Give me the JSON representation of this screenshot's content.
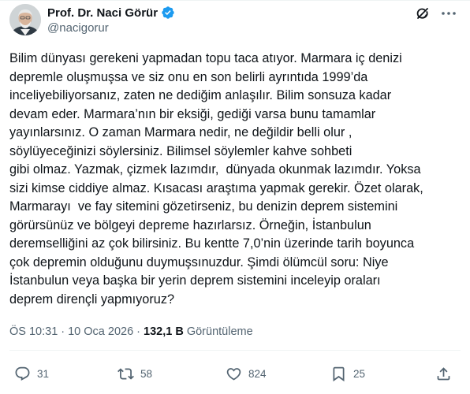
{
  "author": {
    "name": "Prof. Dr. Naci Görür",
    "handle": "@nacigorur",
    "verified": true
  },
  "tweet": {
    "lines": [
      "Bilim dünyası gerekeni yapmadan topu taca atıyor. Marmara iç denizi",
      "depremle oluşmuşsa ve siz onu en son belirli ayrıntıda 1999’da",
      "inceliyebiliyorsanız, zaten ne dediğim anlaşılır. Bilim sonsuza kadar",
      "devam eder. Marmara’nın bir eksiği, gediği varsa bunu tamamlar",
      "yayınlarsınız. O zaman Marmara nedir, ne değildir belli olur ,",
      "söylüyeceğinizi söylersiniz. Bilimsel söylemler kahve sohbeti",
      "gibi olmaz. Yazmak, çizmek lazımdır,  dünyada okunmak lazımdır. Yoksa",
      "sizi kimse ciddiye almaz. Kısacası araştıma yapmak gerekir. Özet olarak,",
      "Marmarayı  ve fay sitemini gözetirseniz, bu denizin deprem sistemini",
      "görürsünüz ve bölgeyi depreme hazırlarsız. Örneğin, İstanbulun",
      "deremselliğini az çok bilirsiniz. Bu kentte 7,0’nin üzerinde tarih boyunca",
      "çok depremin olduğunu duymuşsınuzdur. Şimdi ölümcül soru: Niye",
      "İstanbulun veya başka bir yerin deprem sistemini inceleyip oraları",
      "deprem dirençli yapmıyoruz?"
    ]
  },
  "meta": {
    "time": "ÖS 10:31",
    "separator": "·",
    "date": "10 Oca 2026",
    "views_count": "132,1 B",
    "views_label": "Görüntüleme"
  },
  "actions": {
    "replies": "31",
    "retweets": "58",
    "likes": "824",
    "bookmarks": "25"
  },
  "colors": {
    "text": "#0f1419",
    "secondary": "#536471",
    "verified": "#1d9bf0",
    "divider": "#eff3f4"
  },
  "icons": {
    "grok": "grok-icon",
    "more": "more-horizontal-icon",
    "reply": "reply-icon",
    "retweet": "retweet-icon",
    "like": "heart-icon",
    "bookmark": "bookmark-icon",
    "share": "share-icon"
  }
}
